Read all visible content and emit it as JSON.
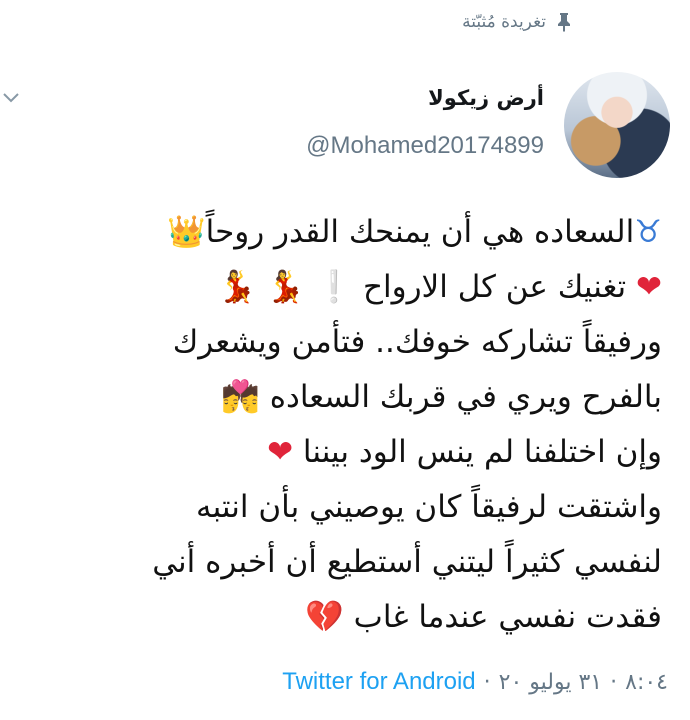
{
  "pinned_label": "تغريدة مُثبّتة",
  "user": {
    "display_name": "أرض زيكولا",
    "handle": "@Mohamed20174899"
  },
  "tweet_lines": [
    {
      "text": "السعاده هي أن يمنحك القدر روحاً",
      "emoji_start": "♉",
      "emoji_end": "👑"
    },
    {
      "text": "تغنيك عن كل الارواح",
      "emoji_start": "❤",
      "emoji_end": "❕ 💃 💃"
    },
    {
      "text": "ورفيقاً تشاركه خوفك.. فتأمن ويشعرك",
      "emoji_start": "",
      "emoji_end": ""
    },
    {
      "text": "بالفرح ويري في قربك السعاده",
      "emoji_start": "",
      "emoji_end": "💏"
    },
    {
      "text": "وإن اختلفنا لم ينس الود بيننا",
      "emoji_start": "",
      "emoji_end": "❤"
    },
    {
      "text": "واشتقت لرفيقاً كان يوصيني بأن انتبه",
      "emoji_start": "",
      "emoji_end": ""
    },
    {
      "text": "لنفسي كثيراً ليتني أستطيع أن أخبره أني",
      "emoji_start": "",
      "emoji_end": ""
    },
    {
      "text": "فقدت نفسي عندما غاب",
      "emoji_start": "",
      "emoji_end": "💔"
    }
  ],
  "footer": {
    "time": "٨:٠٤",
    "date": "٣١ يوليو ٢٠",
    "separator": "·",
    "source": "Twitter for Android"
  },
  "icons": {
    "pin": "pin-icon",
    "chevron": "chevron-down-icon",
    "avatar": "avatar"
  }
}
